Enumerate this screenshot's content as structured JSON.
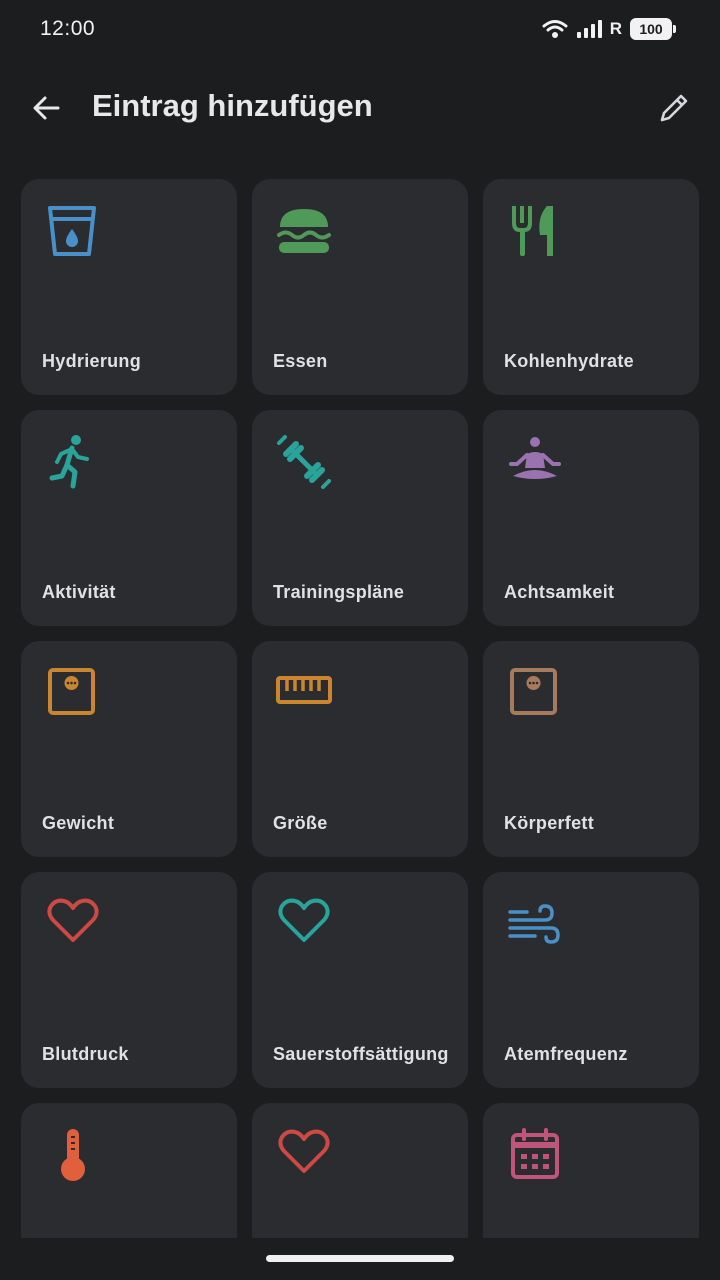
{
  "status_bar": {
    "time": "12:00",
    "network_label": "R",
    "battery": "100"
  },
  "app_bar": {
    "title": "Eintrag hinzufügen"
  },
  "tiles": [
    {
      "label": "Hydrierung",
      "icon": "water-glass-icon",
      "color": "#4a90c8"
    },
    {
      "label": "Essen",
      "icon": "burger-icon",
      "color": "#4f9a58"
    },
    {
      "label": "Kohlenhydrate",
      "icon": "cutlery-icon",
      "color": "#4f9a58"
    },
    {
      "label": "Aktivität",
      "icon": "running-icon",
      "color": "#2aa39a"
    },
    {
      "label": "Trainingspläne",
      "icon": "dumbbell-icon",
      "color": "#2aa39a"
    },
    {
      "label": "Achtsamkeit",
      "icon": "meditation-icon",
      "color": "#9a72b0"
    },
    {
      "label": "Gewicht",
      "icon": "scale-icon",
      "color": "#c98530"
    },
    {
      "label": "Größe",
      "icon": "ruler-icon",
      "color": "#c98530"
    },
    {
      "label": "Körperfett",
      "icon": "scale-icon",
      "color": "#a87a5c"
    },
    {
      "label": "Blutdruck",
      "icon": "heart-icon",
      "color": "#cc4a44"
    },
    {
      "label": "Sauerstoffsättigung",
      "icon": "heart-icon",
      "color": "#2aa39a"
    },
    {
      "label": "Atemfrequenz",
      "icon": "wind-icon",
      "color": "#4a90c8"
    },
    {
      "label": "",
      "icon": "thermometer-icon",
      "color": "#e0603c"
    },
    {
      "label": "",
      "icon": "heart-icon",
      "color": "#cc4a44"
    },
    {
      "label": "",
      "icon": "calendar-icon",
      "color": "#c0557a"
    }
  ]
}
